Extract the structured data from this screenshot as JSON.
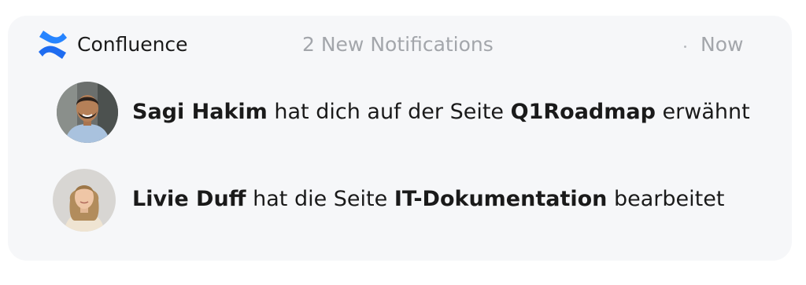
{
  "header": {
    "app_name": "Confluence",
    "notification_count": "2 New Notifications",
    "separator": "·",
    "time": "Now",
    "logo_icon": "confluence-logo",
    "brand_color": "#1f6cf0"
  },
  "notifications": [
    {
      "actor": "Sagi Hakim",
      "action_before": " hat dich auf der Seite ",
      "page": "Q1Roadmap",
      "action_after": " erwähnt",
      "avatar_icon": "avatar-man"
    },
    {
      "actor": "Livie Duff",
      "action_before": " hat die Seite ",
      "page": "IT-Dokumentation",
      "action_after": " bearbeitet",
      "avatar_icon": "avatar-woman"
    }
  ]
}
